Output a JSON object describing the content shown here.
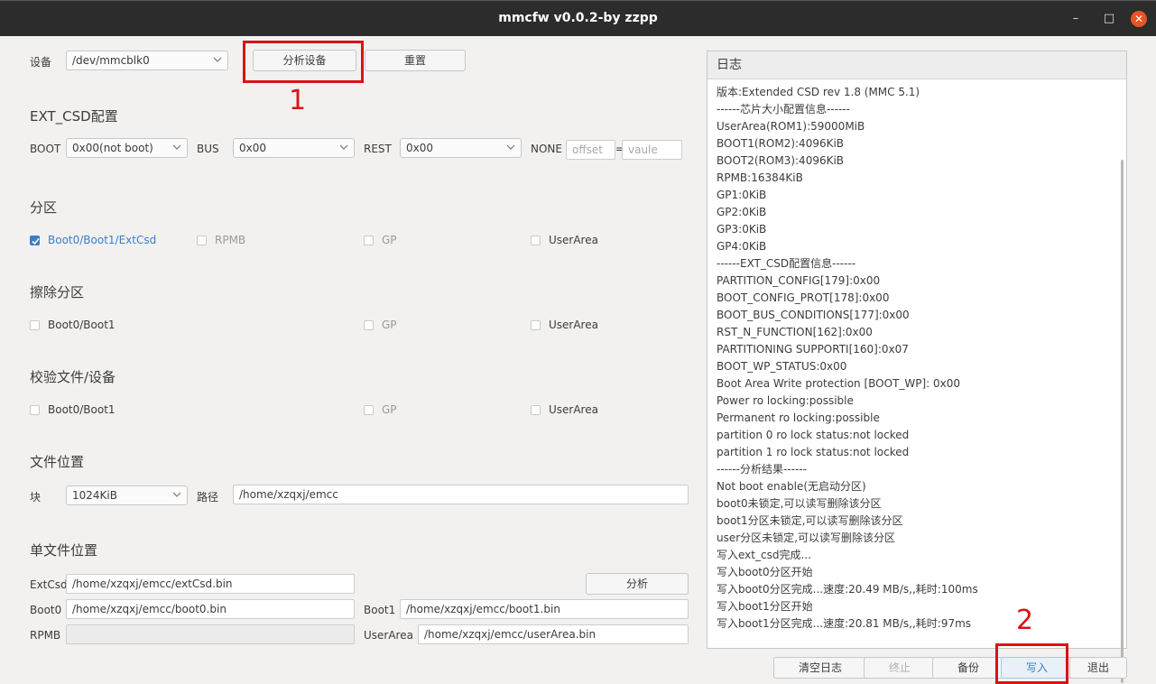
{
  "window": {
    "title": "mmcfw v0.0.2-by zzpp"
  },
  "device": {
    "label": "设备",
    "value": "/dev/mmcblk0",
    "analyze_button": "分析设备",
    "reset_button": "重置"
  },
  "extcsd": {
    "title": "EXT_CSD配置",
    "boot_label": "BOOT",
    "boot_value": "0x00(not boot)",
    "bus_label": "BUS",
    "bus_value": "0x00",
    "rest_label": "REST",
    "rest_value": "0x00",
    "none_label": "NONE",
    "offset_placeholder": "offset",
    "equals": "=",
    "value_placeholder": "vaule"
  },
  "partition": {
    "title": "分区",
    "items": [
      "Boot0/Boot1/ExtCsd",
      "RPMB",
      "GP",
      "UserArea"
    ]
  },
  "erase": {
    "title": "擦除分区",
    "items": [
      "Boot0/Boot1",
      "GP",
      "UserArea"
    ]
  },
  "verify": {
    "title": "校验文件/设备",
    "items": [
      "Boot0/Boot1",
      "GP",
      "UserArea"
    ]
  },
  "filepos": {
    "title": "文件位置",
    "block_label": "块",
    "block_value": "1024KiB",
    "path_label": "路径",
    "path_value": "/home/xzqxj/emcc"
  },
  "singlefile": {
    "title": "单文件位置",
    "extcsd_label": "ExtCsd",
    "extcsd_value": "/home/xzqxj/emcc/extCsd.bin",
    "analyze_button": "分析",
    "boot0_label": "Boot0",
    "boot0_value": "/home/xzqxj/emcc/boot0.bin",
    "boot1_label": "Boot1",
    "boot1_value": "/home/xzqxj/emcc/boot1.bin",
    "rpmb_label": "RPMB",
    "userarea_label": "UserArea",
    "userarea_value": "/home/xzqxj/emcc/userArea.bin"
  },
  "log": {
    "title": "日志",
    "lines": [
      "版本:Extended CSD rev 1.8 (MMC 5.1)",
      "------芯片大小配置信息------",
      "UserArea(ROM1):59000MiB",
      "BOOT1(ROM2):4096KiB",
      "BOOT2(ROM3):4096KiB",
      "RPMB:16384KiB",
      "GP1:0KiB",
      "GP2:0KiB",
      "GP3:0KiB",
      "GP4:0KiB",
      "------EXT_CSD配置信息------",
      "PARTITION_CONFIG[179]:0x00",
      "BOOT_CONFIG_PROT[178]:0x00",
      "BOOT_BUS_CONDITIONS[177]:0x00",
      "RST_N_FUNCTION[162]:0x00",
      "PARTITIONING SUPPORTI[160]:0x07",
      "BOOT_WP_STATUS:0x00",
      "Boot Area Write protection [BOOT_WP]: 0x00",
      "Power ro locking:possible",
      "Permanent ro locking:possible",
      "partition 0 ro lock status:not locked",
      "partition 1 ro lock status:not locked",
      "------分析结果------",
      "Not boot enable(无启动分区)",
      "boot0未锁定,可以读写删除该分区",
      "boot1分区未锁定,可以读写删除该分区",
      "user分区未锁定,可以读写删除该分区",
      "写入ext_csd完成...",
      "写入boot0分区开始",
      "写入boot0分区完成...速度:20.49 MB/s,,耗时:100ms",
      "写入boot1分区开始",
      "写入boot1分区完成...速度:20.81 MB/s,,耗时:97ms"
    ]
  },
  "footer": {
    "clear_log": "清空日志",
    "stop": "终止",
    "backup": "备份",
    "write": "写入",
    "exit": "退出"
  },
  "annotations": {
    "one": "1",
    "two": "2",
    "color": "#d81414"
  }
}
